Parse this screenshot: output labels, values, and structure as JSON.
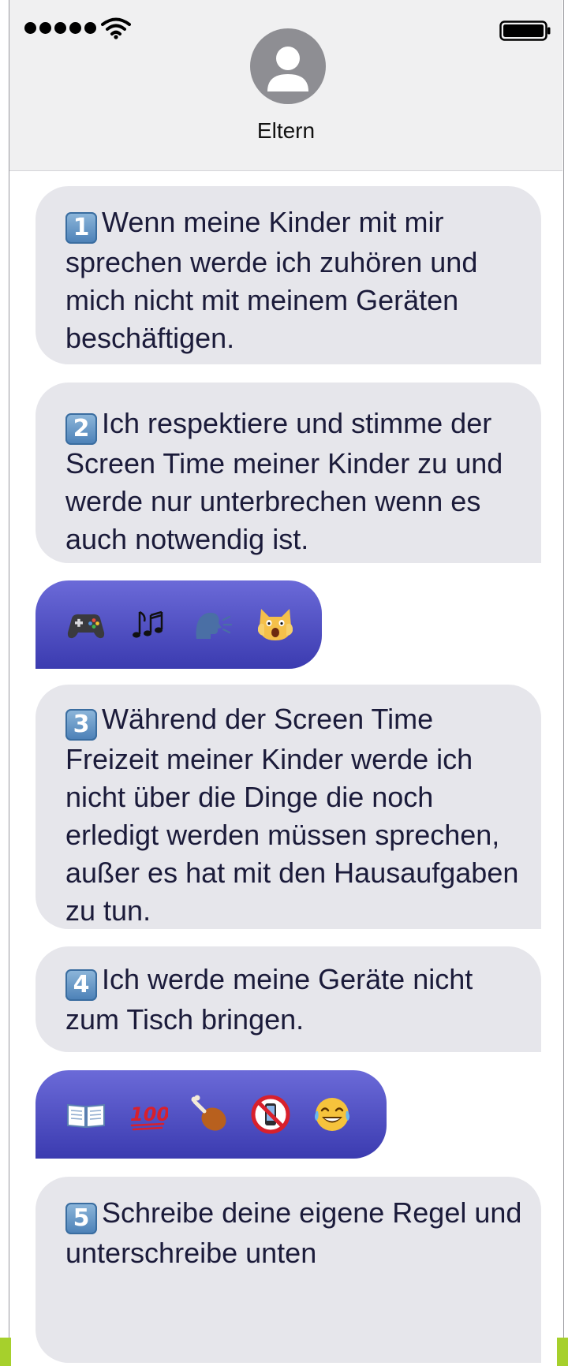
{
  "status_bar": {
    "signal_dots": 5,
    "battery_level": 1.0
  },
  "contact": {
    "name": "Eltern",
    "icon": "person-icon"
  },
  "messages": [
    {
      "type": "received",
      "number": "1",
      "text": "Wenn meine Kinder mit mir sprechen werde ich zuhören und mich nicht mit meinem Geräten beschäftigen."
    },
    {
      "type": "received",
      "number": "2",
      "text": "Ich respektiere und stimme der Screen Time meiner Kinder zu und werde nur unterbrechen wenn es auch notwendig ist."
    },
    {
      "type": "sent-emoji",
      "emojis": [
        "video-game-controller-icon",
        "musical-notes-icon",
        "speaking-head-icon",
        "weary-cat-icon"
      ]
    },
    {
      "type": "received",
      "number": "3",
      "text": "Während der Screen Time Freizeit meiner Kinder werde ich nicht über die Dinge die noch erledigt werden müssen sprechen, außer es hat mit den Hausaufgaben zu tun."
    },
    {
      "type": "received",
      "number": "4",
      "text": "Ich werde meine Geräte nicht zum Tisch bringen."
    },
    {
      "type": "sent-emoji",
      "emojis": [
        "open-book-icon",
        "hundred-points-icon",
        "poultry-leg-icon",
        "no-mobile-phones-icon",
        "tears-of-joy-icon"
      ]
    },
    {
      "type": "received",
      "number": "5",
      "text": "Schreibe deine eigene Regel und unterschreibe unten"
    }
  ],
  "colors": {
    "header_bg": "#f0f0f1",
    "received_bubble": "#e6e6eb",
    "received_text": "#1b1b3a",
    "sent_bubble_top": "#6b6ad8",
    "sent_bubble_bottom": "#3b3bb0",
    "accent_green": "#a6d02c"
  }
}
